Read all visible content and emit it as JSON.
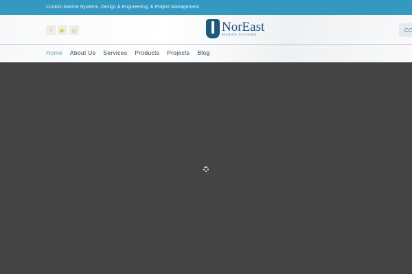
{
  "topbar": {
    "tagline": "Custom Marine Systems, Design & Engineering, & Project Management"
  },
  "header": {
    "social": [
      {
        "icon": "facebook-icon",
        "glyph": "f"
      },
      {
        "icon": "youtube-icon",
        "glyph": "▶"
      },
      {
        "icon": "instagram-icon",
        "glyph": "◎"
      }
    ],
    "logo": {
      "name": "NorEast",
      "sub": "MARINE SYSTEMS"
    },
    "cta_label": "CO"
  },
  "nav": {
    "items": [
      {
        "label": "Home"
      },
      {
        "label": "About Us"
      },
      {
        "label": "Services"
      },
      {
        "label": "Products"
      },
      {
        "label": "Projects"
      },
      {
        "label": "Blog"
      }
    ]
  }
}
